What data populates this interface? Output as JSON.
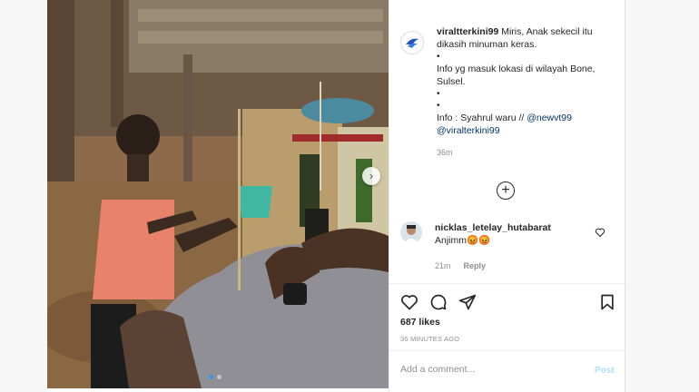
{
  "post": {
    "username": "viraltterkini99",
    "caption_lines": [
      "Miris, Anak sekecil itu",
      "dikasih minuman keras."
    ],
    "bullet": "•",
    "info_location": "Info yg masuk lokasi di wilayah Bone, Sulsel.",
    "info_credit_prefix": "Info : Syahrul waru // ",
    "mention_1": "@newvt99",
    "mention_2": "@viralterkini99",
    "caption_time": "36m",
    "load_more_symbol": "+"
  },
  "comment": {
    "username": "nicklas_letelay_hutabarat",
    "text": "Anjimm😡😡",
    "time": "21m",
    "reply_label": "Reply"
  },
  "actions": {
    "likes": "687 likes",
    "timestamp": "36 MINUTES AGO"
  },
  "composer": {
    "placeholder": "Add a comment...",
    "post_label": "Post"
  },
  "media": {
    "next_arrow": "›",
    "slide_count": 2,
    "active_slide": 0
  },
  "colors": {
    "link": "#00376b",
    "accent": "#3897f0",
    "post_disabled": "#b2dffc",
    "muted": "#8e8e8e"
  },
  "icons": [
    "heart-icon",
    "comment-icon",
    "share-icon",
    "bookmark-icon",
    "plus-circle-icon",
    "chevron-right-icon"
  ]
}
